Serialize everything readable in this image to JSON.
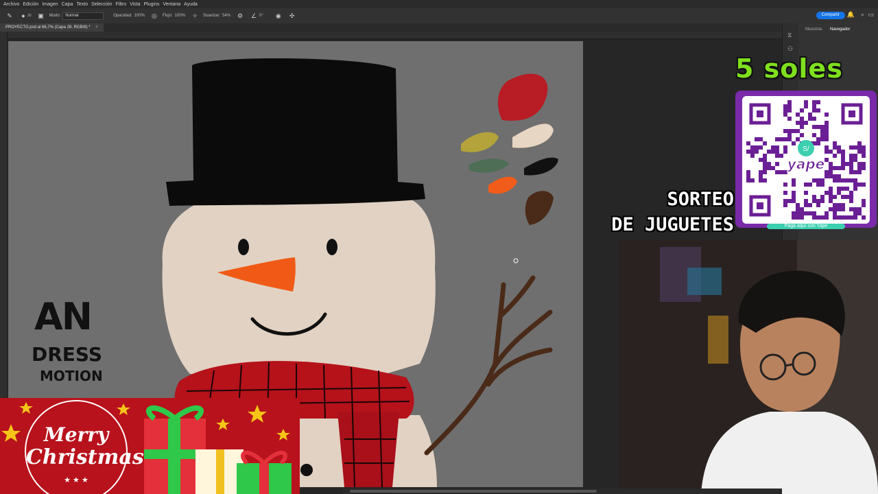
{
  "menu": [
    "Archivo",
    "Edición",
    "Imagen",
    "Capa",
    "Texto",
    "Selección",
    "Filtro",
    "Vista",
    "Plugins",
    "Ventana",
    "Ayuda"
  ],
  "options": {
    "mode_label": "Modo:",
    "mode_value": "Normal",
    "opacity_label": "Opacidad:",
    "opacity_value": "100%",
    "flow_label": "Flujo:",
    "flow_value": "100%",
    "smooth_label": "Suavizar:",
    "smooth_value": "54%",
    "angle_value": "0°",
    "brush_size": "20"
  },
  "share_label": "Compartir",
  "document_tab": "PROYECTO.psd al 66,7% (Capa 28, RGB/8) *",
  "panel": {
    "tab1": "Muestras",
    "tab2": "Navegador"
  },
  "overlay": {
    "price": "5 soles",
    "qr_brand": "yape",
    "qr_symbol": "S/",
    "qr_caption": "Paga aquí con Yape",
    "raffle_line1": "SORTEO",
    "raffle_line2": "DE JUGUETES"
  },
  "logo": {
    "line1": "AN",
    "line2": "DRESS",
    "line3": "MOTION"
  },
  "banner": {
    "line1": "Merry",
    "line2": "Christmas"
  },
  "colors": {
    "accent": "#1473e6",
    "price": "#7fe01e",
    "qr_card": "#7a2aa8",
    "banner": "#b8121c",
    "palette": [
      "#b81c24",
      "#e8d6c4",
      "#b3a33a",
      "#4e6e55",
      "#111111",
      "#f25c1a",
      "#4a2a18"
    ]
  }
}
